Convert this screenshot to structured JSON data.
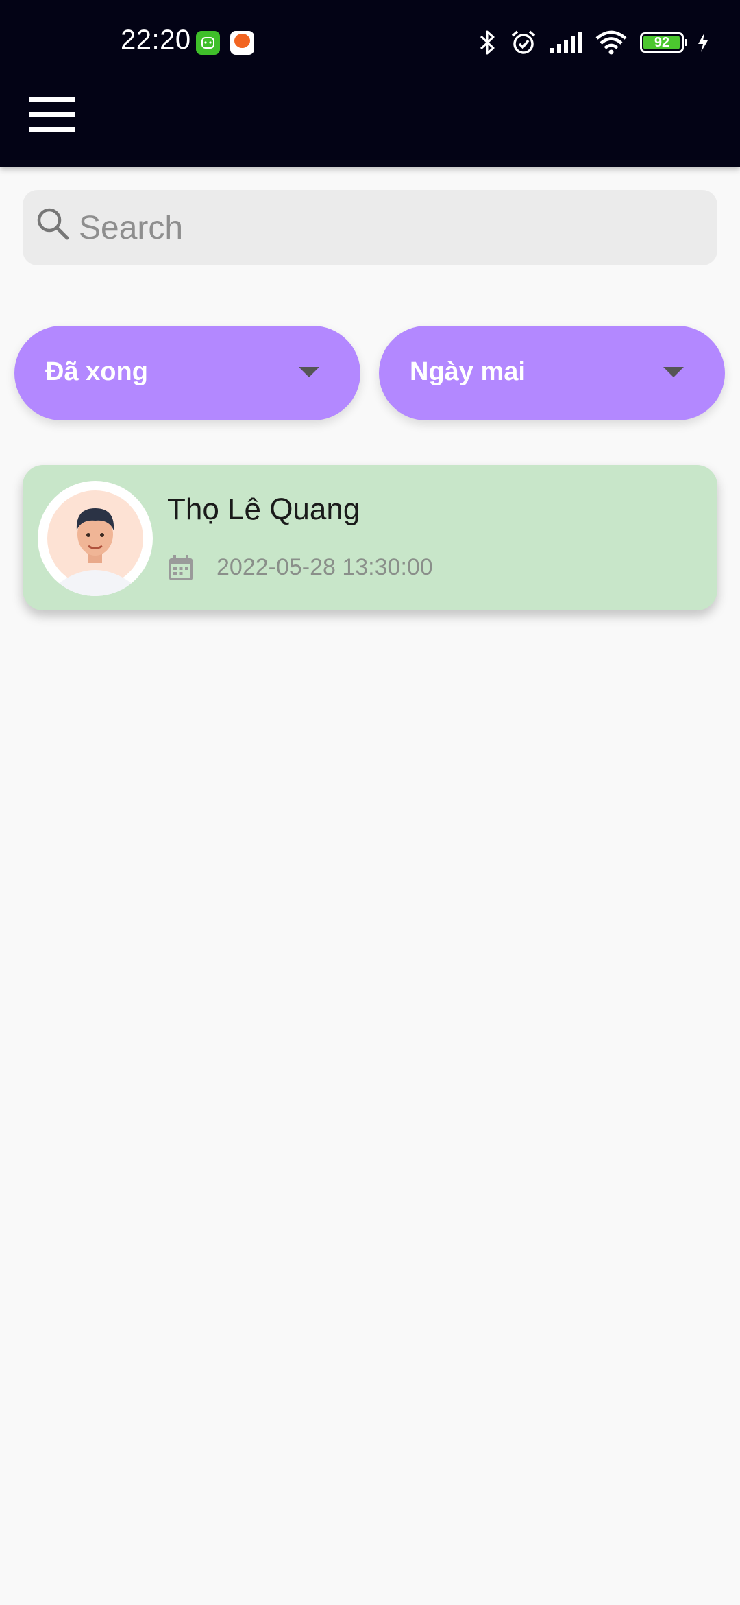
{
  "status_bar": {
    "time": "22:20",
    "battery": "92",
    "battery_level": 0.92,
    "icons": [
      "app-notification-green-icon",
      "app-notification-orange-icon",
      "bluetooth-icon",
      "alarm-icon",
      "signal-icon",
      "wifi-icon",
      "battery-icon",
      "charging-icon"
    ]
  },
  "header": {
    "menu_icon": "hamburger-menu-icon",
    "background": "#030315"
  },
  "search": {
    "placeholder": "Search",
    "value": "",
    "icon": "search-icon"
  },
  "filters": {
    "status": {
      "selected": "Đã xong",
      "icon": "dropdown-arrow-icon"
    },
    "date": {
      "selected": "Ngày mai",
      "icon": "dropdown-arrow-icon"
    },
    "accent_color": "#b388ff"
  },
  "appointments": [
    {
      "name": "Thọ Lê Quang",
      "datetime": "2022-05-28 13:30:00",
      "avatar_icon": "user-avatar",
      "date_icon": "calendar-icon",
      "background": "#c8e6c9"
    }
  ]
}
